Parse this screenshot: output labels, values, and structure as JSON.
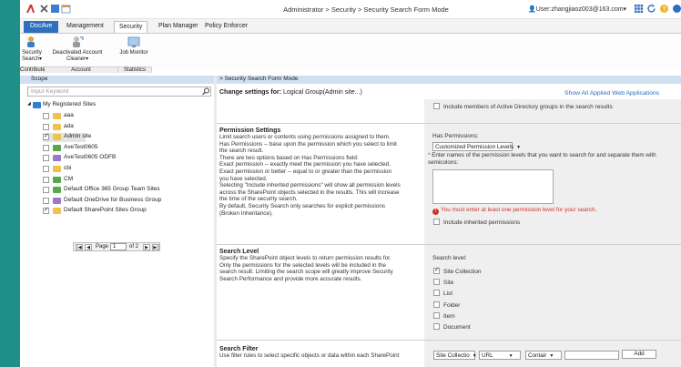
{
  "window": {
    "title": "Administrator > Security > Security Search Form Mode",
    "user": "User:zhangjiaoz003@163.com",
    "user_caret": "▾"
  },
  "tabs": [
    {
      "label": "DocAve"
    },
    {
      "label": "Management"
    },
    {
      "label": "Security"
    },
    {
      "label": "Plan Manager"
    },
    {
      "label": "Policy Enforcer"
    }
  ],
  "ribbon": {
    "buttons": [
      {
        "label": "Security Search▾",
        "icon": "security-search-icon"
      },
      {
        "label": "Deactivated Account Cleaner▾",
        "icon": "account-cleaner-icon"
      },
      {
        "label": "Job Monitor",
        "icon": "job-monitor-icon"
      }
    ],
    "groups": [
      "Contribute",
      "Account",
      "Statistics"
    ]
  },
  "scope": {
    "header": "Scope",
    "search_placeholder": "Input Keyword",
    "tree_root": "My Registered Sites",
    "sites": [
      {
        "label": "aaa",
        "checked": false,
        "color": "#f0c24c"
      },
      {
        "label": "ada",
        "checked": false,
        "color": "#f0c24c"
      },
      {
        "label": "Admin site",
        "checked": true,
        "color": "#f0c24c"
      },
      {
        "label": "AveTest0605",
        "checked": false,
        "color": "#59a84b"
      },
      {
        "label": "AveTest0605 ODFB",
        "checked": false,
        "color": "#9a7ac8"
      },
      {
        "label": "cbi",
        "checked": false,
        "color": "#f0c24c"
      },
      {
        "label": "CM",
        "checked": false,
        "color": "#59a84b"
      },
      {
        "label": "Default Office 365 Group Team Sites",
        "checked": false,
        "color": "#59a84b"
      },
      {
        "label": "Default OneDrive for Business Group",
        "checked": false,
        "color": "#9a7ac8"
      },
      {
        "label": "Default SharePoint Sites Group",
        "checked": true,
        "color": "#f0c24c"
      }
    ],
    "pager": {
      "page_label": "Page",
      "page": "1",
      "of": "of 2"
    }
  },
  "main": {
    "header": "Security Search Form Mode",
    "change_label": "Change settings for:",
    "change_value": "Logical Group(Admin site...)",
    "show_all": "Show All Applied Web Applications",
    "ad_groups_option": "Include members of Active Directory groups in the search results",
    "permission": {
      "title": "Permission Settings",
      "desc": [
        "Limit search users or contents using permissions assigned to them.",
        "Has Permissions -- base upon the permission which you select to limit",
        "the search result.",
        "There are two options based on Has Permissions field:",
        "Exact permission -- exactly meet the permission you have selected.",
        "Exact permission or better -- equal to or greater than the permission",
        "you have selected.",
        "Selecting \"Include inherited permissions\" will show all permission levels",
        "across the SharePoint objects selected in the results. This will increase",
        "the time of the security search.",
        "By default, Security Search only searches for explicit permissions",
        "(Broken Inheritance)."
      ],
      "has_label": "Has Permissions:",
      "select_value": "Customized Permission Levels",
      "required_star": "*",
      "instructions": "Enter names of the permission levels that you want to search for and separate them with semicolons:",
      "error": "You must enter at least one permission level for your search.",
      "inherited_option": "Include inherited permissions"
    },
    "search_level": {
      "title": "Search Level",
      "desc": [
        "Specify the SharePoint object levels to return permission results for.",
        "Only the permissions for the selected levels will be included in the",
        "search result. Limiting the search scope will greatly improve Security",
        "Search Performance and provide more accurate results."
      ],
      "label": "Search level:",
      "options": [
        {
          "label": "Site Collection",
          "checked": true
        },
        {
          "label": "Site",
          "checked": false
        },
        {
          "label": "List",
          "checked": false
        },
        {
          "label": "Folder",
          "checked": false
        },
        {
          "label": "Item",
          "checked": false
        },
        {
          "label": "Document",
          "checked": false
        }
      ]
    },
    "search_filter": {
      "title": "Search Filter",
      "desc": "Use filter rules to select specific objects or data within each SharePoint",
      "field1": "Site Collectio",
      "field2": "URL",
      "field3": "Contair",
      "add": "Add"
    }
  }
}
